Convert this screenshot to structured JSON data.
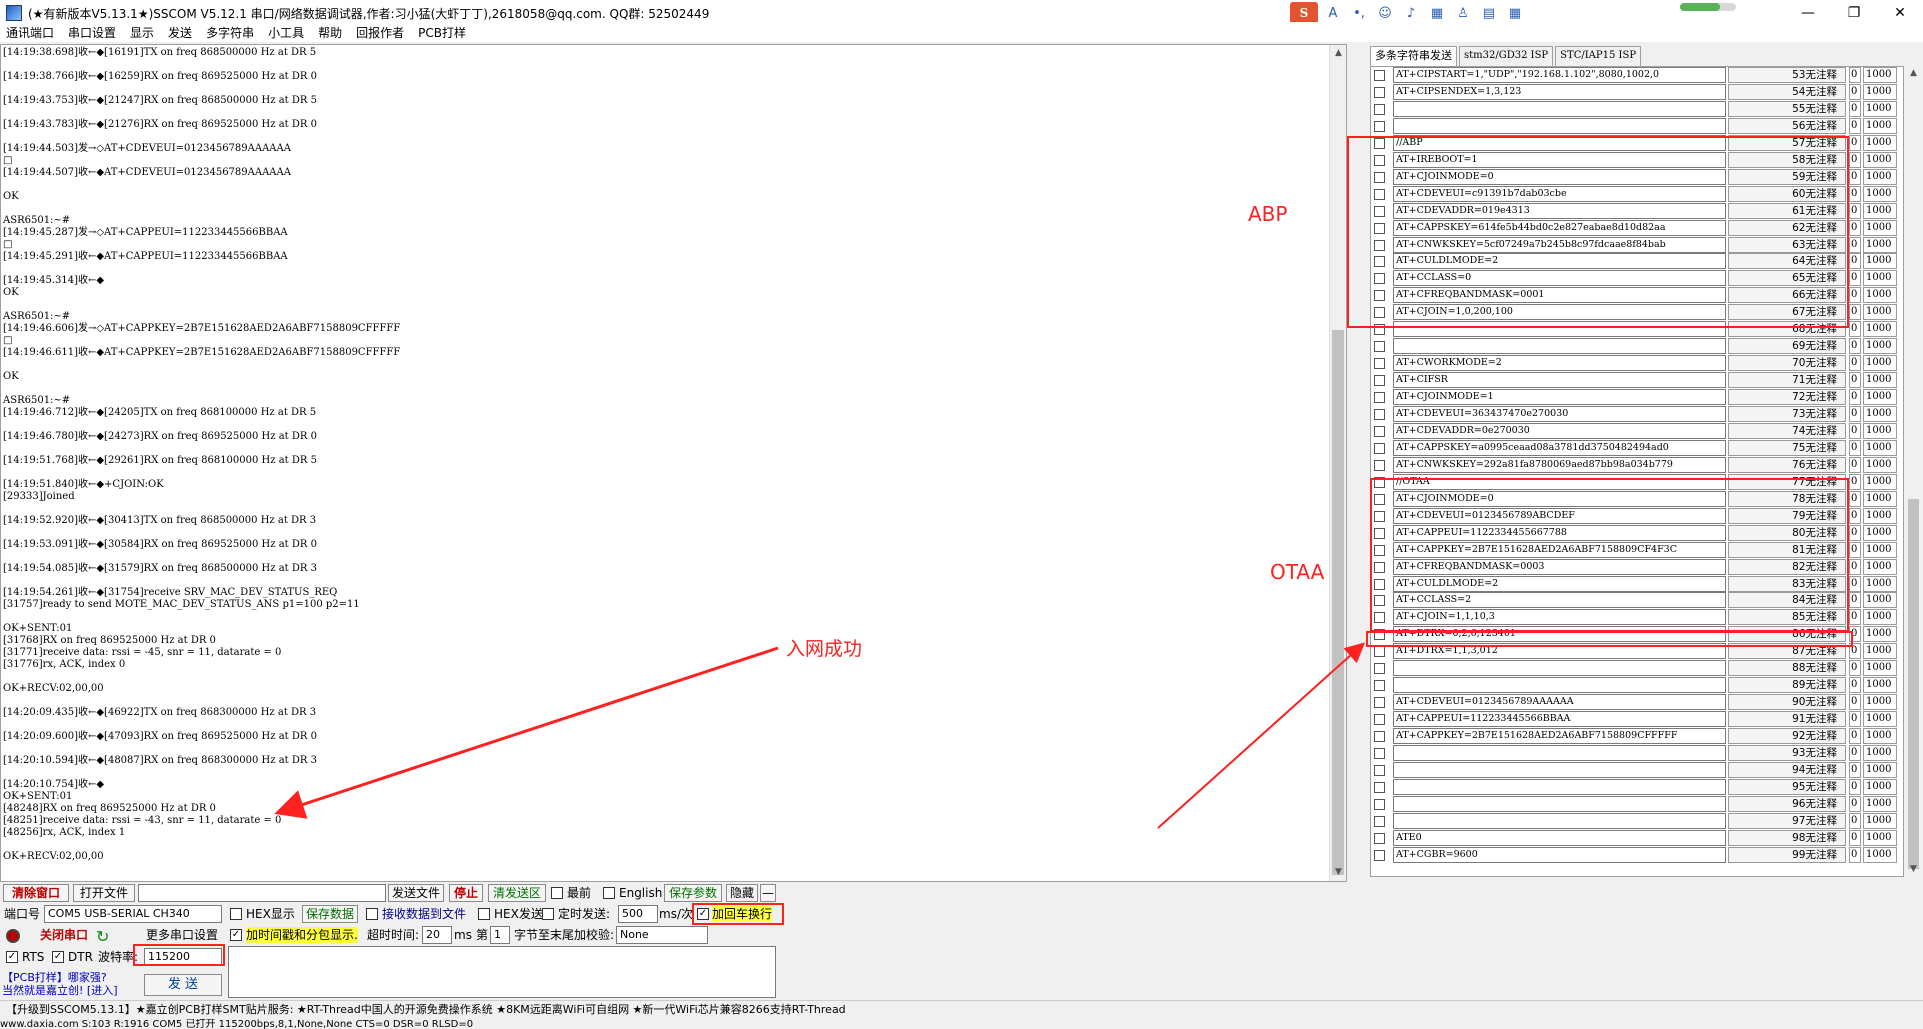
{
  "window": {
    "title": "(★有新版本V5.13.1★)SSCOM V5.12.1 串口/网络数据调试器,作者:习小猛(大虾丁丁),2618058@qq.com. QQ群: 52502449"
  },
  "ime": {
    "logo": "S",
    "items": [
      "A",
      "•,",
      "☺",
      "♪",
      "▦",
      "♙",
      "▤",
      "▦"
    ]
  },
  "menu": [
    "通讯端口",
    "串口设置",
    "显示",
    "发送",
    "多字符串",
    "小工具",
    "帮助",
    "回报作者",
    "PCB打样"
  ],
  "log": "[14:19:38.698]收←◆[16191]TX on freq 868500000 Hz at DR 5\n\n[14:19:38.766]收←◆[16259]RX on freq 869525000 Hz at DR 0\n\n[14:19:43.753]收←◆[21247]RX on freq 868500000 Hz at DR 5\n\n[14:19:43.783]收←◆[21276]RX on freq 869525000 Hz at DR 0\n\n[14:19:44.503]发→◇AT+CDEVEUI=0123456789AAAAAA\n□\n[14:19:44.507]收←◆AT+CDEVEUI=0123456789AAAAAA\n\nOK\n\nASR6501:~#\n[14:19:45.287]发→◇AT+CAPPEUI=112233445566BBAA\n□\n[14:19:45.291]收←◆AT+CAPPEUI=112233445566BBAA\n\n[14:19:45.314]收←◆\nOK\n\nASR6501:~#\n[14:19:46.606]发→◇AT+CAPPKEY=2B7E151628AED2A6ABF7158809CFFFFF\n□\n[14:19:46.611]收←◆AT+CAPPKEY=2B7E151628AED2A6ABF7158809CFFFFF\n\nOK\n\nASR6501:~#\n[14:19:46.712]收←◆[24205]TX on freq 868100000 Hz at DR 5\n\n[14:19:46.780]收←◆[24273]RX on freq 869525000 Hz at DR 0\n\n[14:19:51.768]收←◆[29261]RX on freq 868100000 Hz at DR 5\n\n[14:19:51.840]收←◆+CJOIN:OK\n[29333]Joined\n\n[14:19:52.920]收←◆[30413]TX on freq 868500000 Hz at DR 3\n\n[14:19:53.091]收←◆[30584]RX on freq 869525000 Hz at DR 0\n\n[14:19:54.085]收←◆[31579]RX on freq 868500000 Hz at DR 3\n\n[14:19:54.261]收←◆[31754]receive SRV_MAC_DEV_STATUS_REQ\n[31757]ready to send MOTE_MAC_DEV_STATUS_ANS p1=100 p2=11\n\nOK+SENT:01\n[31768]RX on freq 869525000 Hz at DR 0\n[31771]receive data: rssi = -45, snr = 11, datarate = 0\n[31776]rx, ACK, index 0\n\nOK+RECV:02,00,00\n\n[14:20:09.435]收←◆[46922]TX on freq 868300000 Hz at DR 3\n\n[14:20:09.600]收←◆[47093]RX on freq 869525000 Hz at DR 0\n\n[14:20:10.594]收←◆[48087]RX on freq 868300000 Hz at DR 3\n\n[14:20:10.754]收←◆\nOK+SENT:01\n[48248]RX on freq 869525000 Hz at DR 0\n[48251]receive data: rssi = -43, snr = 11, datarate = 0\n[48256]rx, ACK, index 1\n\nOK+RECV:02,00,00",
  "tabs": [
    "多条字符串发送",
    "stm32/GD32 ISP",
    "STC/IAP15 ISP"
  ],
  "rows": [
    {
      "cmd": "AT+CIPSTART=1,\"UDP\",\"192.168.1.102\",8080,1002,0",
      "note": "53无注释",
      "z": "0",
      "ms": "1000"
    },
    {
      "cmd": "AT+CIPSENDEX=1,3,123",
      "note": "54无注释",
      "z": "0",
      "ms": "1000"
    },
    {
      "cmd": "",
      "note": "55无注释",
      "z": "0",
      "ms": "1000"
    },
    {
      "cmd": "",
      "note": "56无注释",
      "z": "0",
      "ms": "1000"
    },
    {
      "cmd": "//ABP",
      "note": "57无注释",
      "z": "0",
      "ms": "1000"
    },
    {
      "cmd": "AT+IREBOOT=1",
      "note": "58无注释",
      "z": "0",
      "ms": "1000"
    },
    {
      "cmd": "AT+CJOINMODE=0",
      "note": "59无注释",
      "z": "0",
      "ms": "1000"
    },
    {
      "cmd": "AT+CDEVEUI=c91391b7dab03cbe",
      "note": "60无注释",
      "z": "0",
      "ms": "1000"
    },
    {
      "cmd": "AT+CDEVADDR=019e4313",
      "note": "61无注释",
      "z": "0",
      "ms": "1000"
    },
    {
      "cmd": "AT+CAPPSKEY=614fe5b44bd0c2e827eabae8d10d82aa",
      "note": "62无注释",
      "z": "0",
      "ms": "1000"
    },
    {
      "cmd": "AT+CNWKSKEY=5cf07249a7b245b8c97fdcaae8f84bab",
      "note": "63无注释",
      "z": "0",
      "ms": "1000"
    },
    {
      "cmd": "AT+CULDLMODE=2",
      "note": "64无注释",
      "z": "0",
      "ms": "1000"
    },
    {
      "cmd": "AT+CCLASS=0",
      "note": "65无注释",
      "z": "0",
      "ms": "1000"
    },
    {
      "cmd": "AT+CFREQBANDMASK=0001",
      "note": "66无注释",
      "z": "0",
      "ms": "1000"
    },
    {
      "cmd": "AT+CJOIN=1,0,200,100",
      "note": "67无注释",
      "z": "0",
      "ms": "1000"
    },
    {
      "cmd": "",
      "note": "68无注释",
      "z": "0",
      "ms": "1000"
    },
    {
      "cmd": "",
      "note": "69无注释",
      "z": "0",
      "ms": "1000"
    },
    {
      "cmd": "AT+CWORKMODE=2",
      "note": "70无注释",
      "z": "0",
      "ms": "1000"
    },
    {
      "cmd": "AT+CIFSR",
      "note": "71无注释",
      "z": "0",
      "ms": "1000"
    },
    {
      "cmd": "AT+CJOINMODE=1",
      "note": "72无注释",
      "z": "0",
      "ms": "1000"
    },
    {
      "cmd": "AT+CDEVEUI=363437470e270030",
      "note": "73无注释",
      "z": "0",
      "ms": "1000"
    },
    {
      "cmd": "AT+CDEVADDR=0e270030",
      "note": "74无注释",
      "z": "0",
      "ms": "1000"
    },
    {
      "cmd": "AT+CAPPSKEY=a0995ceaad08a3781dd3750482494ad0",
      "note": "75无注释",
      "z": "0",
      "ms": "1000"
    },
    {
      "cmd": "AT+CNWKSKEY=292a81fa8780069aed87bb98a034b779",
      "note": "76无注释",
      "z": "0",
      "ms": "1000"
    },
    {
      "cmd": "//OTAA",
      "note": "77无注释",
      "z": "0",
      "ms": "1000"
    },
    {
      "cmd": "AT+CJOINMODE=0",
      "note": "78无注释",
      "z": "0",
      "ms": "1000"
    },
    {
      "cmd": "AT+CDEVEUI=0123456789ABCDEF",
      "note": "79无注释",
      "z": "0",
      "ms": "1000"
    },
    {
      "cmd": "AT+CAPPEUI=1122334455667788",
      "note": "80无注释",
      "z": "0",
      "ms": "1000"
    },
    {
      "cmd": "AT+CAPPKEY=2B7E151628AED2A6ABF7158809CF4F3C",
      "note": "81无注释",
      "z": "0",
      "ms": "1000"
    },
    {
      "cmd": "AT+CFREQBANDMASK=0003",
      "note": "82无注释",
      "z": "0",
      "ms": "1000"
    },
    {
      "cmd": "AT+CULDLMODE=2",
      "note": "83无注释",
      "z": "0",
      "ms": "1000"
    },
    {
      "cmd": "AT+CCLASS=2",
      "note": "84无注释",
      "z": "0",
      "ms": "1000"
    },
    {
      "cmd": "AT+CJOIN=1,1,10,3",
      "note": "85无注释",
      "z": "0",
      "ms": "1000"
    },
    {
      "cmd": "AT+DTRX=0,2,6,123401",
      "note": "86无注释",
      "z": "0",
      "ms": "1000"
    },
    {
      "cmd": "AT+DTRX=1,1,3,012",
      "note": "87无注释",
      "z": "0",
      "ms": "1000"
    },
    {
      "cmd": "",
      "note": "88无注释",
      "z": "0",
      "ms": "1000"
    },
    {
      "cmd": "",
      "note": "89无注释",
      "z": "0",
      "ms": "1000"
    },
    {
      "cmd": "AT+CDEVEUI=0123456789AAAAAA",
      "note": "90无注释",
      "z": "0",
      "ms": "1000"
    },
    {
      "cmd": "AT+CAPPEUI=112233445566BBAA",
      "note": "91无注释",
      "z": "0",
      "ms": "1000"
    },
    {
      "cmd": "AT+CAPPKEY=2B7E151628AED2A6ABF7158809CFFFFF",
      "note": "92无注释",
      "z": "0",
      "ms": "1000"
    },
    {
      "cmd": "",
      "note": "93无注释",
      "z": "0",
      "ms": "1000"
    },
    {
      "cmd": "",
      "note": "94无注释",
      "z": "0",
      "ms": "1000"
    },
    {
      "cmd": "",
      "note": "95无注释",
      "z": "0",
      "ms": "1000"
    },
    {
      "cmd": "",
      "note": "96无注释",
      "z": "0",
      "ms": "1000"
    },
    {
      "cmd": "",
      "note": "97无注释",
      "z": "0",
      "ms": "1000"
    },
    {
      "cmd": "ATE0",
      "note": "98无注释",
      "z": "0",
      "ms": "1000"
    },
    {
      "cmd": "AT+CGBR=9600",
      "note": "99无注释",
      "z": "0",
      "ms": "1000"
    }
  ],
  "toolbar": {
    "clear": "清除窗口",
    "open_file": "打开文件",
    "file_path": "",
    "send_file": "发送文件",
    "stop": "停止",
    "clear_send": "清发送区",
    "last": "最前",
    "english": "English",
    "save_params": "保存参数",
    "hide": "隐藏",
    "minus": "—"
  },
  "controls": {
    "port_label": "端口号",
    "port_value": "COM5 USB-SERIAL CH340",
    "hex_show": "HEX显示",
    "save_data": "保存数据",
    "recv_to_file": "接收数据到文件",
    "hex_send": "HEX发送",
    "timed_send": "定时发送:",
    "interval": "500",
    "interval_unit": "ms/次",
    "add_crlf": "加回车换行",
    "close_port": "关闭串口",
    "more_settings": "更多串口设置",
    "timestamp": "加时间戳和分包显示.",
    "timeout_label": "超时时间:",
    "timeout": "20",
    "timeout_unit": "ms",
    "nth": "第",
    "nth_value": "1",
    "byte_check": "字节至末尾加校验:",
    "check_value": "None",
    "rts": "RTS",
    "dtr": "DTR",
    "baud_label": "波特率:",
    "baud": "115200",
    "send": "发  送",
    "promo1": "【PCB打样】哪家强?",
    "promo2": "当然就是嘉立创! [进入]"
  },
  "status": "【升级到SSCOM5.13.1】★嘉立创PCB打样SMT贴片服务: ★RT-Thread中国人的开源免费操作系统 ★8KM远距离WiFi可自组网 ★新一代WiFi芯片兼容8266支持RT-Thread",
  "status2": "www.daxia.com   S:103     R:1916     COM5 已打开  115200bps,8,1,None,None          CTS=0 DSR=0 RLSD=0",
  "annotations": {
    "abp": "ABP",
    "otaa": "OTAA",
    "joined": "入网成功"
  },
  "colors": {
    "annotation": "#ff2020"
  }
}
